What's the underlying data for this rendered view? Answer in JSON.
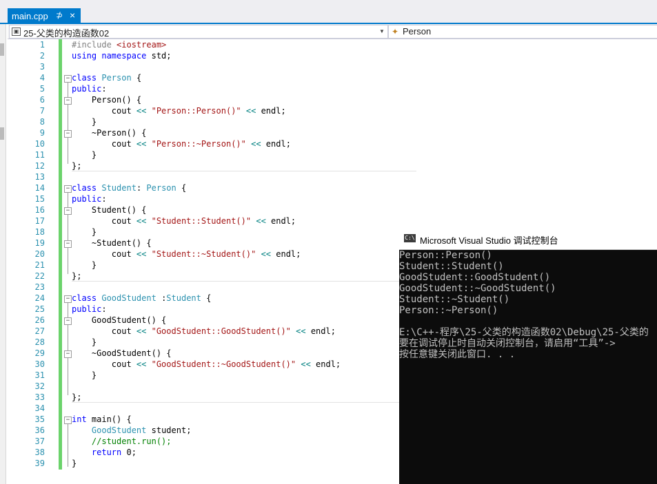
{
  "tab": {
    "name": "main.cpp",
    "pin": "⊅",
    "close": "×"
  },
  "navbar": {
    "scope": "25-父类的构造函数02",
    "member": "Person"
  },
  "editor": {
    "line_numbers": [
      "1",
      "2",
      "3",
      "4",
      "5",
      "6",
      "7",
      "8",
      "9",
      "10",
      "11",
      "12",
      "13",
      "14",
      "15",
      "16",
      "17",
      "18",
      "19",
      "20",
      "21",
      "22",
      "23",
      "24",
      "25",
      "26",
      "27",
      "28",
      "29",
      "30",
      "31",
      "32",
      "33",
      "34",
      "35",
      "36",
      "37",
      "38",
      "39"
    ]
  },
  "console": {
    "title": "Microsoft Visual Studio 调试控制台",
    "lines": [
      "Person::Person()",
      "Student::Student()",
      "GoodStudent::GoodStudent()",
      "GoodStudent::~GoodStudent()",
      "Student::~Student()",
      "Person::~Person()",
      "",
      "E:\\C++-程序\\25-父类的构造函数02\\Debug\\25-父类的",
      "要在调试停止时自动关闭控制台，请启用“工具”->",
      "按任意键关闭此窗口. . ."
    ]
  },
  "colors": {
    "accent": "#007acc",
    "changebar": "#6bd36b",
    "keyword": "#0000ff",
    "type": "#2b91af",
    "string": "#a31515"
  }
}
